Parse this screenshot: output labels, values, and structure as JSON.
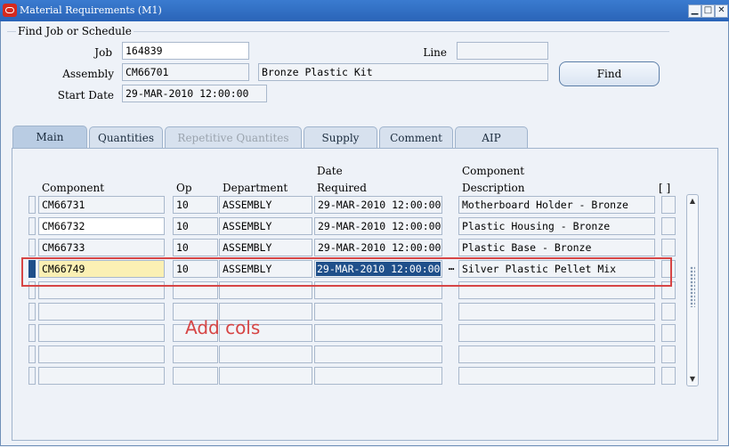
{
  "window": {
    "title": "Material Requirements (M1)",
    "minimize": "▁",
    "maximize": "□",
    "close": "✕"
  },
  "find": {
    "group_label": "Find Job or Schedule",
    "job_label": "Job",
    "job_value": "164839",
    "line_label": "Line",
    "line_value": "",
    "assembly_label": "Assembly",
    "assembly_value": "CM66701",
    "assembly_desc": "Bronze Plastic Kit",
    "start_label": "Start Date",
    "start_value": "29-MAR-2010 12:00:00",
    "find_button": "Find"
  },
  "tabs": [
    {
      "label": "Main",
      "active": true
    },
    {
      "label": "Quantities"
    },
    {
      "label": "Repetitive Quantites",
      "disabled": true
    },
    {
      "label": "Supply"
    },
    {
      "label": "Comment"
    },
    {
      "label": "AIP"
    }
  ],
  "table": {
    "headers": {
      "component": "Component",
      "op": "Op",
      "department": "Department",
      "date_line1": "Date",
      "date_line2": "Required",
      "desc_line1": "Component",
      "desc_line2": "Description",
      "flex": "[ ]"
    },
    "rows": [
      {
        "component": "CM66731",
        "op": "10",
        "department": "ASSEMBLY",
        "date": "29-MAR-2010 12:00:00",
        "description": "Motherboard Holder - Bronze"
      },
      {
        "component": "CM66732",
        "op": "10",
        "department": "ASSEMBLY",
        "date": "29-MAR-2010 12:00:00",
        "description": "Plastic Housing - Bronze"
      },
      {
        "component": "CM66733",
        "op": "10",
        "department": "ASSEMBLY",
        "date": "29-MAR-2010 12:00:00",
        "description": "Plastic Base - Bronze"
      },
      {
        "component": "CM66749",
        "op": "10",
        "department": "ASSEMBLY",
        "date": "29-MAR-2010 12:00:00",
        "description": "Silver Plastic Pellet Mix"
      },
      {
        "component": "",
        "op": "",
        "department": "",
        "date": "",
        "description": ""
      },
      {
        "component": "",
        "op": "",
        "department": "",
        "date": "",
        "description": ""
      },
      {
        "component": "",
        "op": "",
        "department": "",
        "date": "",
        "description": ""
      },
      {
        "component": "",
        "op": "",
        "department": "",
        "date": "",
        "description": ""
      },
      {
        "component": "",
        "op": "",
        "department": "",
        "date": "",
        "description": ""
      }
    ],
    "lov_button": "…",
    "scroll_up": "▲",
    "scroll_down": "▼"
  },
  "annotation": {
    "text": "Add cols",
    "color": "#d64545"
  },
  "colors": {
    "titlebar": "#2a64b8",
    "selection": "#1f4f8a",
    "current_field": "#fbf0b4",
    "highlight_box": "#d64545"
  }
}
